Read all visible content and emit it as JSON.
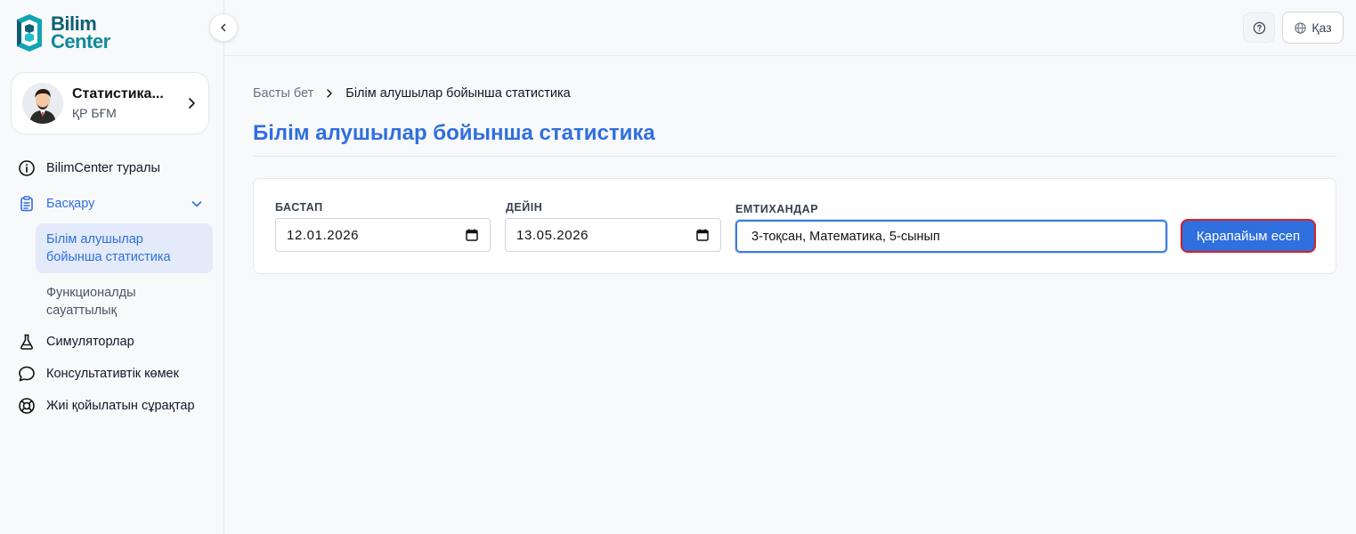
{
  "brand": {
    "line1": "Bilim",
    "line2": "Center"
  },
  "profile": {
    "name": "Статистика...",
    "org": "ҚР БҒМ"
  },
  "nav": {
    "about": "BilimCenter туралы",
    "manage": "Басқару",
    "sub_items": [
      "Білім алушылар бойынша статистика",
      "Функционалды сауаттылық"
    ],
    "simulators": "Симуляторлар",
    "consult": "Консультативтік көмек",
    "faq": "Жиі қойылатын сұрақтар"
  },
  "topbar": {
    "lang_label": "Қаз"
  },
  "breadcrumb": {
    "home": "Басты бет",
    "current": "Білім алушылар бойынша статистика"
  },
  "page": {
    "title": "Білім алушылар бойынша статистика"
  },
  "filters": {
    "start_label": "БАСТАП",
    "start_value": "12.01.2026",
    "end_label": "ДЕЙІН",
    "end_value": "13.05.2026",
    "exams_label": "ЕМТИХАНДАР",
    "exams_value": "3-тоқсан, Математика, 5-сынып",
    "submit_label": "Қарапайым есеп"
  },
  "colors": {
    "accent": "#2f6fde",
    "brand": "#0e8a9a",
    "active_bg": "#e3ebfa",
    "focus_outline": "#d6202a"
  },
  "icons": {
    "about": "info-circle-icon",
    "manage": "clipboard-icon",
    "simulators": "flask-icon",
    "consult": "chat-bubble-icon",
    "faq": "lifebuoy-icon"
  }
}
